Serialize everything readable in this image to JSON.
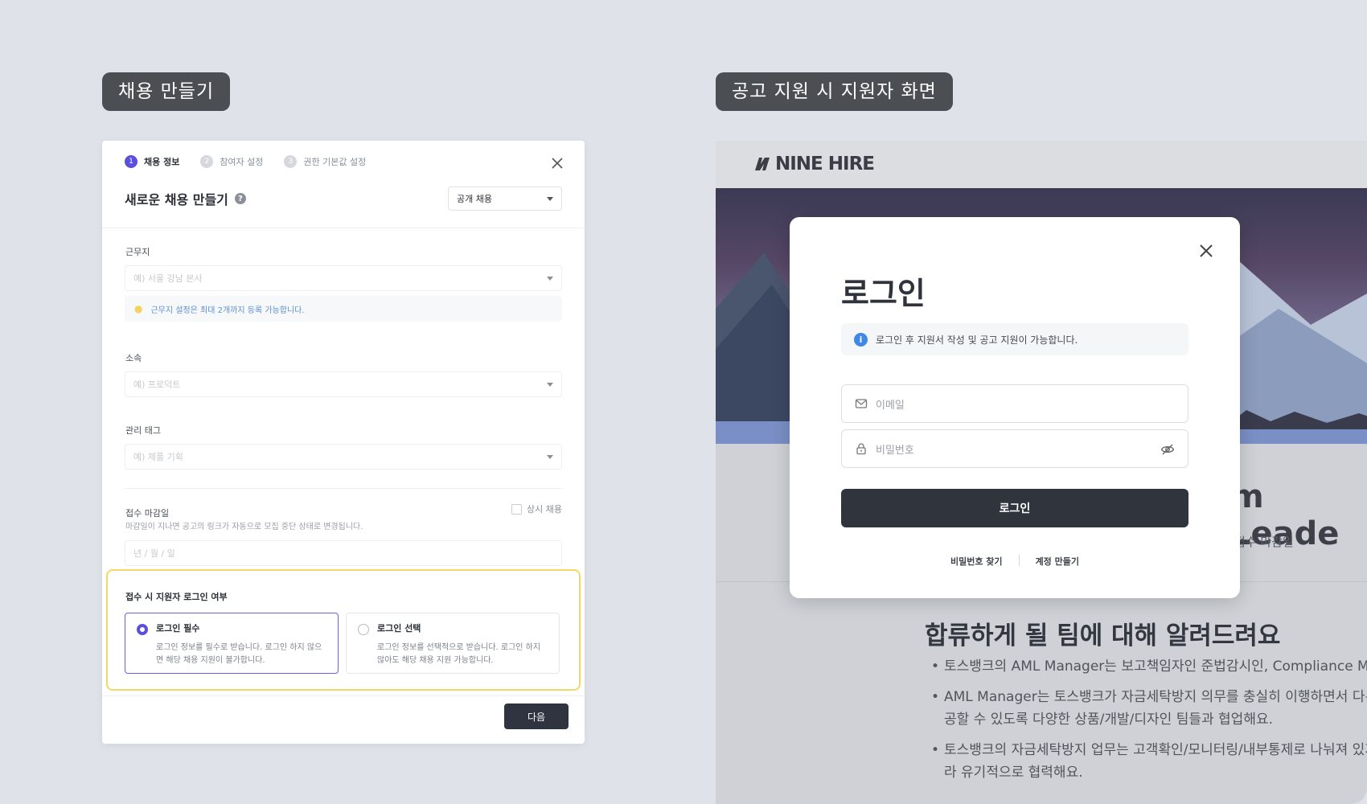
{
  "labels": {
    "left": "채용 만들기",
    "right": "공고 지원 시 지원자 화면"
  },
  "card": {
    "steps": [
      {
        "num": "1",
        "label": "채용 정보"
      },
      {
        "num": "2",
        "label": "참여자 설정"
      },
      {
        "num": "3",
        "label": "권한 기본값 설정"
      }
    ],
    "title": "새로운 채용 만들기",
    "help_glyph": "?",
    "type_select": "공개 채용",
    "fields": {
      "workplace_label": "근무지",
      "workplace_placeholder": "예) 서울 강남 본사",
      "workplace_tip": "근무지 설정은 최대 2개까지 등록 가능합니다.",
      "team_label": "소속",
      "team_placeholder": "예) 프로덕트",
      "tag_label": "관리 태그",
      "tag_placeholder": "예) 제품 기획",
      "deadline_label": "접수 마감일",
      "deadline_desc": "마감일이 지나면 공고의 링크가 자동으로 모집 중단 상태로 변경됩니다.",
      "always_label": "상시 채용",
      "date_placeholder": "년 / 월 / 일"
    },
    "login": {
      "title": "접수 시 지원자 로그인 여부",
      "options": [
        {
          "title": "로그인 필수",
          "desc": "로그인 정보를 필수로 받습니다. 로그인 하지 않으면 해당 채용 지원이 불가합니다.",
          "selected": true
        },
        {
          "title": "로그인 선택",
          "desc": "로그인 정보를 선택적으로 받습니다. 로그인 하지 않아도 해당 채용 지원 가능합니다.",
          "selected": false
        }
      ]
    },
    "next_label": "다음"
  },
  "screen": {
    "logo": "NINE HIRE",
    "job_title_fragment": "m Leade",
    "deadline_fragment": "접수 마감일",
    "section_title": "합류하게 될 팀에 대해 알려드려요",
    "bullets": [
      "토스뱅크의 AML Manager는 보고책임자인 준법감시인, Compliance Ma",
      "AML Manager는 토스뱅크가 자금세탁방지 의무를 충실히 이행하면서 다른 제공할 수 있도록 다양한 상품/개발/디자인 팀들과 협업해요.",
      "토스뱅크의 자금세탁방지 업무는 고객확인/모니터링/내부통제로 나눠져 있지 따라 유기적으로 협력해요."
    ],
    "modal": {
      "title": "로그인",
      "info": "로그인 후 지원서 작성 및 공고 지원이 가능합니다.",
      "email_placeholder": "이메일",
      "password_placeholder": "비밀번호",
      "login_button": "로그인",
      "find_password": "비밀번호 찾기",
      "create_account": "계정 만들기"
    }
  },
  "colors": {
    "accent": "#5b4fe0",
    "highlight": "#f4d76a",
    "dark_button": "#30343d",
    "info": "#3f88e3"
  }
}
